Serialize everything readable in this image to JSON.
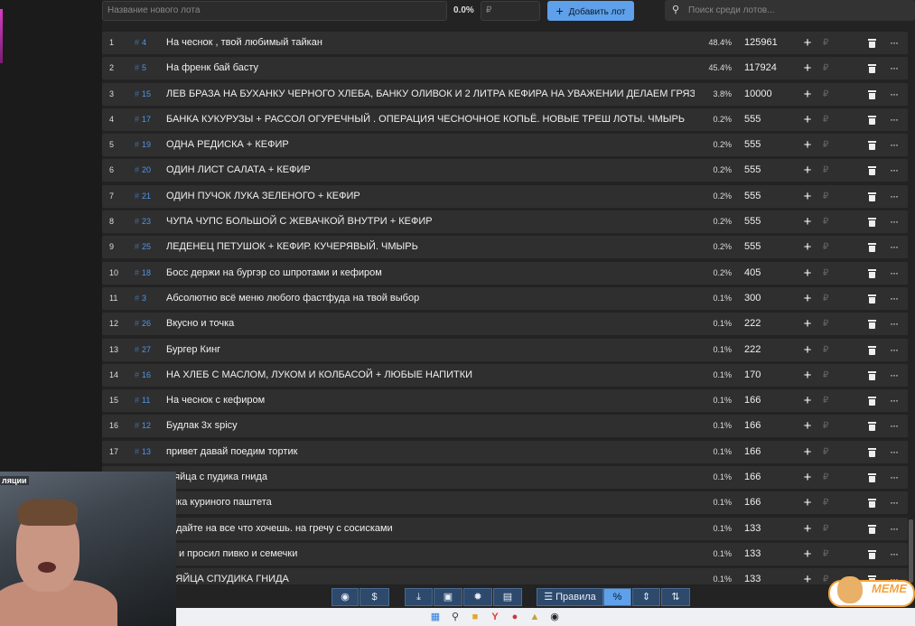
{
  "topbar": {
    "new_lot_placeholder": "Название нового лота",
    "percent": "0.0%",
    "currency_placeholder": "₽",
    "add_button": "Добавить лот",
    "search_placeholder": "Поиск среди лотов..."
  },
  "lots": [
    {
      "n": "1",
      "id": "4",
      "name": "На чеснок , твой любимый тайкан",
      "pct": "48.4%",
      "amount": "125961"
    },
    {
      "n": "2",
      "id": "5",
      "name": "На френк бай басту",
      "pct": "45.4%",
      "amount": "117924"
    },
    {
      "n": "3",
      "id": "15",
      "name": "ЛЕВ БРАЗА НА БУХАНКУ ЧЕРНОГО ХЛЕБА, БАНКУ ОЛИВОК И 2 ЛИТРА КЕФИРА НА УВАЖЕНИИ ДЕЛАЕМ ГРЯЗНО",
      "pct": "3.8%",
      "amount": "10000"
    },
    {
      "n": "4",
      "id": "17",
      "name": "БАНКА КУКУРУЗЫ + РАССОЛ ОГУРЕЧНЫЙ . ОПЕРАЦИЯ ЧЕСНОЧНОЕ КОПЬЁ. НОВЫЕ ТРЕШ ЛОТЫ. ЧМЫРЬ",
      "pct": "0.2%",
      "amount": "555"
    },
    {
      "n": "5",
      "id": "19",
      "name": "ОДНА РЕДИСКА + КЕФИР",
      "pct": "0.2%",
      "amount": "555"
    },
    {
      "n": "6",
      "id": "20",
      "name": "ОДИН ЛИСТ САЛАТА + КЕФИР",
      "pct": "0.2%",
      "amount": "555"
    },
    {
      "n": "7",
      "id": "21",
      "name": "ОДИН ПУЧОК ЛУКА ЗЕЛЕНОГО + КЕФИР",
      "pct": "0.2%",
      "amount": "555"
    },
    {
      "n": "8",
      "id": "23",
      "name": "ЧУПА ЧУПС БОЛЬШОЙ С ЖЕВАЧКОЙ ВНУТРИ + КЕФИР",
      "pct": "0.2%",
      "amount": "555"
    },
    {
      "n": "9",
      "id": "25",
      "name": "ЛЕДЕНЕЦ ПЕТУШОК + КЕФИР. КУЧЕРЯВЫЙ. ЧМЫРЬ",
      "pct": "0.2%",
      "amount": "555"
    },
    {
      "n": "10",
      "id": "18",
      "name": "Босс держи на бургэр со шпротами и кефиром",
      "pct": "0.2%",
      "amount": "405"
    },
    {
      "n": "11",
      "id": "3",
      "name": "Абсолютно всё меню любого фастфуда на твой выбор",
      "pct": "0.1%",
      "amount": "300"
    },
    {
      "n": "12",
      "id": "26",
      "name": "Вкусно и точка",
      "pct": "0.1%",
      "amount": "222"
    },
    {
      "n": "13",
      "id": "27",
      "name": "Бургер Кинг",
      "pct": "0.1%",
      "amount": "222"
    },
    {
      "n": "14",
      "id": "16",
      "name": "НА ХЛЕБ С МАСЛОМ, ЛУКОМ И КОЛБАСОЙ + ЛЮБЫЕ НАПИТКИ",
      "pct": "0.1%",
      "amount": "170"
    },
    {
      "n": "15",
      "id": "11",
      "name": "На чеснок с кефиром",
      "pct": "0.1%",
      "amount": "166"
    },
    {
      "n": "16",
      "id": "12",
      "name": "Будлак 3х spicy",
      "pct": "0.1%",
      "amount": "166"
    },
    {
      "n": "17",
      "id": "13",
      "name": "привет давай поедим тортик",
      "pct": "0.1%",
      "amount": "166"
    },
    {
      "n": "",
      "id": "",
      "name": "а яйца с пудика гнида",
      "pct": "0.1%",
      "amount": "166"
    },
    {
      "n": "",
      "id": "",
      "name": "анка куриного паштета",
      "pct": "0.1%",
      "amount": "166"
    },
    {
      "n": "",
      "id": "",
      "name": "кидайте на все что хочешь. на гречу с сосисками",
      "pct": "0.1%",
      "amount": "133"
    },
    {
      "n": "",
      "id": "",
      "name": "ак и просил пивко и семечки",
      "pct": "0.1%",
      "amount": "133"
    },
    {
      "n": "",
      "id": "",
      "name": "А ЯЙЦА СПУДИКА ГНИДА",
      "pct": "0.1%",
      "amount": "133"
    }
  ],
  "row_icons": {
    "add": "+",
    "currency": "₽",
    "menu": "···"
  },
  "toolbar": {
    "github_icon": "github-icon",
    "donate": "$",
    "download_icon": "download-icon",
    "save_icon": "save-icon",
    "bug_icon": "bug-icon",
    "sheet_icon": "sheet-icon",
    "rules_label": "Правила",
    "percent": "%",
    "move": "⇕",
    "sort": "⇅"
  },
  "webcam_caption": "ляции",
  "sticker_text": "MEME"
}
